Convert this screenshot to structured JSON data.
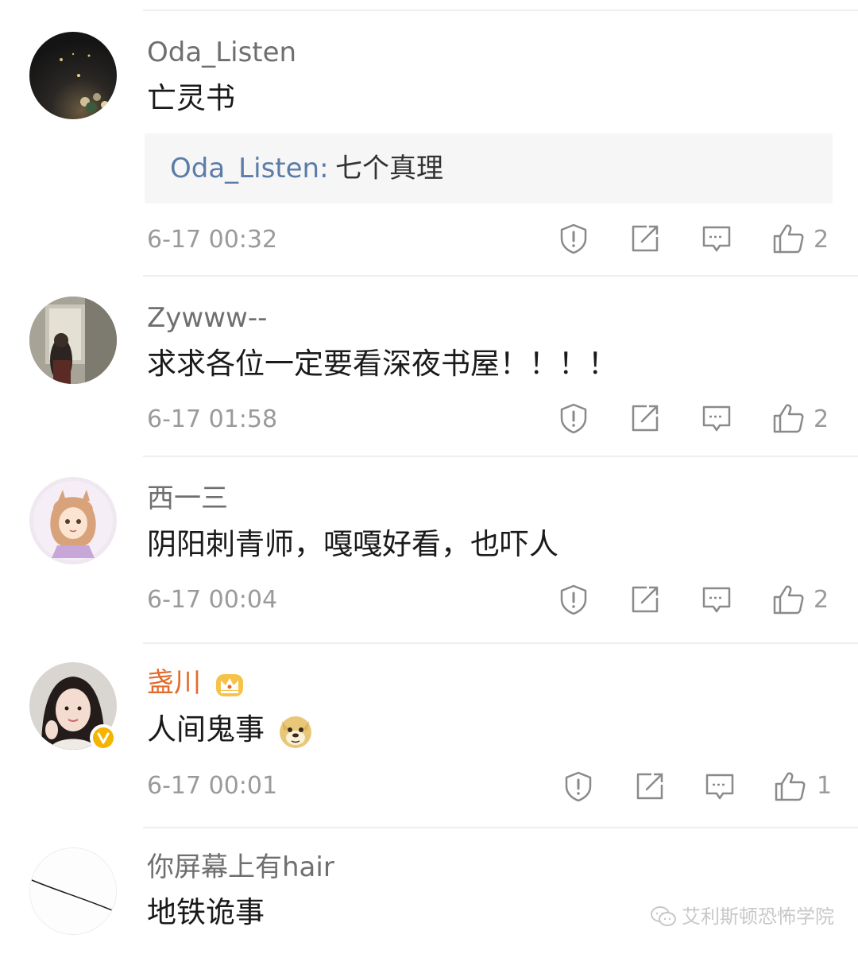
{
  "comments": [
    {
      "username": "Oda_Listen",
      "text": "亡灵书",
      "reply": {
        "author": "Oda_Listen:",
        "text": "七个真理"
      },
      "time": "6-17 00:32",
      "likes": "2",
      "avatar": "night-lights-avatar"
    },
    {
      "username": "Zywww--",
      "text": "求求各位一定要看深夜书屋！！！！",
      "time": "6-17 01:58",
      "likes": "2",
      "avatar": "mirror-selfie-avatar"
    },
    {
      "username": "西一三",
      "text": "阴阳刺青师，嘎嘎好看，也吓人",
      "time": "6-17 00:04",
      "likes": "2",
      "avatar": "cartoon-girl-avatar"
    },
    {
      "username": "盏川",
      "text": "人间鬼事",
      "time": "6-17 00:01",
      "likes": "1",
      "avatar": "girl-photo-avatar",
      "username_color": "#e36a2b",
      "badges": [
        "crown-icon",
        "verified-v-icon",
        "doge-emoji-icon"
      ]
    },
    {
      "username": "你屏幕上有hair",
      "text": "地铁诡事",
      "avatar": "hair-line-avatar"
    }
  ],
  "watermark": "艾利斯顿恐怖学院",
  "colors": {
    "link_blue": "#5b7ca8",
    "vip_orange": "#e36a2b",
    "meta_gray": "#9a9a9a"
  }
}
